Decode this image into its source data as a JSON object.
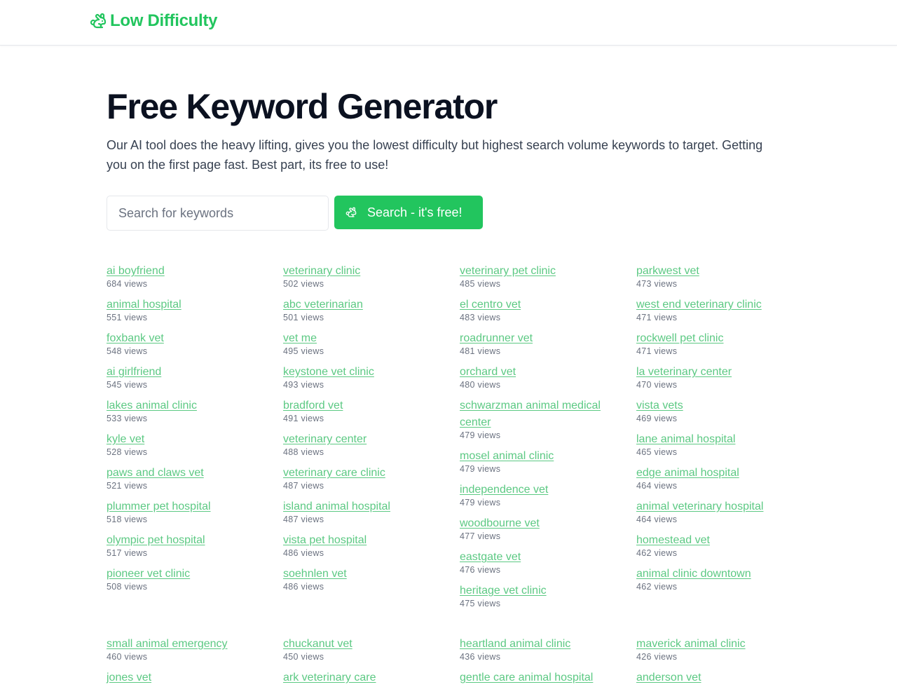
{
  "header": {
    "brand_name": "Low Difficulty",
    "brand_icon": "rabbit-icon",
    "brand_color": "#22c55e"
  },
  "hero": {
    "title": "Free Keyword Generator",
    "subtitle": "Our AI tool does the heavy lifting, gives you the lowest difficulty but highest search volume keywords to target. Getting you on the first page fast. Best part, its free to use!"
  },
  "search": {
    "placeholder": "Search for keywords",
    "value": "",
    "button_label": "Search - it's free!",
    "button_icon": "rabbit-icon",
    "button_color": "#22c55e"
  },
  "keywords_group1": [
    [
      {
        "term": "ai boyfriend",
        "views": "684 views"
      },
      {
        "term": "animal hospital",
        "views": "551 views"
      },
      {
        "term": "foxbank vet",
        "views": "548 views"
      },
      {
        "term": "ai girlfriend",
        "views": "545 views"
      },
      {
        "term": "lakes animal clinic",
        "views": "533 views"
      },
      {
        "term": "kyle vet",
        "views": "528 views"
      },
      {
        "term": "paws and claws vet",
        "views": "521 views"
      },
      {
        "term": "plummer pet hospital",
        "views": "518 views"
      },
      {
        "term": "olympic pet hospital",
        "views": "517 views"
      },
      {
        "term": "pioneer vet clinic",
        "views": "508 views"
      }
    ],
    [
      {
        "term": "veterinary clinic",
        "views": "502 views"
      },
      {
        "term": "abc veterinarian",
        "views": "501 views"
      },
      {
        "term": "vet me",
        "views": "495 views"
      },
      {
        "term": "keystone vet clinic",
        "views": "493 views"
      },
      {
        "term": "bradford vet",
        "views": "491 views"
      },
      {
        "term": "veterinary center",
        "views": "488 views"
      },
      {
        "term": "veterinary care clinic",
        "views": "487 views"
      },
      {
        "term": "island animal hospital",
        "views": "487 views"
      },
      {
        "term": "vista pet hospital",
        "views": "486 views"
      },
      {
        "term": "soehnlen vet",
        "views": "486 views"
      }
    ],
    [
      {
        "term": "veterinary pet clinic",
        "views": "485 views"
      },
      {
        "term": "el centro vet",
        "views": "483 views"
      },
      {
        "term": "roadrunner vet",
        "views": "481 views"
      },
      {
        "term": "orchard vet",
        "views": "480 views"
      },
      {
        "term": "schwarzman animal medical center",
        "views": "479 views"
      },
      {
        "term": "mosel animal clinic",
        "views": "479 views"
      },
      {
        "term": "independence vet",
        "views": "479 views"
      },
      {
        "term": "woodbourne vet",
        "views": "477 views"
      },
      {
        "term": "eastgate vet",
        "views": "476 views"
      },
      {
        "term": "heritage vet clinic",
        "views": "475 views"
      }
    ],
    [
      {
        "term": "parkwest vet",
        "views": "473 views"
      },
      {
        "term": "west end veterinary clinic",
        "views": "471 views"
      },
      {
        "term": "rockwell pet clinic",
        "views": "471 views"
      },
      {
        "term": "la veterinary center",
        "views": "470 views"
      },
      {
        "term": "vista vets",
        "views": "469 views"
      },
      {
        "term": "lane animal hospital",
        "views": "465 views"
      },
      {
        "term": "edge animal hospital",
        "views": "464 views"
      },
      {
        "term": "animal veterinary hospital",
        "views": "464 views"
      },
      {
        "term": "homestead vet",
        "views": "462 views"
      },
      {
        "term": "animal clinic downtown",
        "views": "462 views"
      }
    ]
  ],
  "keywords_group2": [
    [
      {
        "term": "small animal emergency",
        "views": "460 views"
      },
      {
        "term": "jones vet",
        "views": ""
      }
    ],
    [
      {
        "term": "chuckanut vet",
        "views": "450 views"
      },
      {
        "term": "ark veterinary care",
        "views": ""
      }
    ],
    [
      {
        "term": "heartland animal clinic",
        "views": "436 views"
      },
      {
        "term": "gentle care animal hospital",
        "views": ""
      }
    ],
    [
      {
        "term": "maverick animal clinic",
        "views": "426 views"
      },
      {
        "term": "anderson vet",
        "views": ""
      }
    ]
  ]
}
